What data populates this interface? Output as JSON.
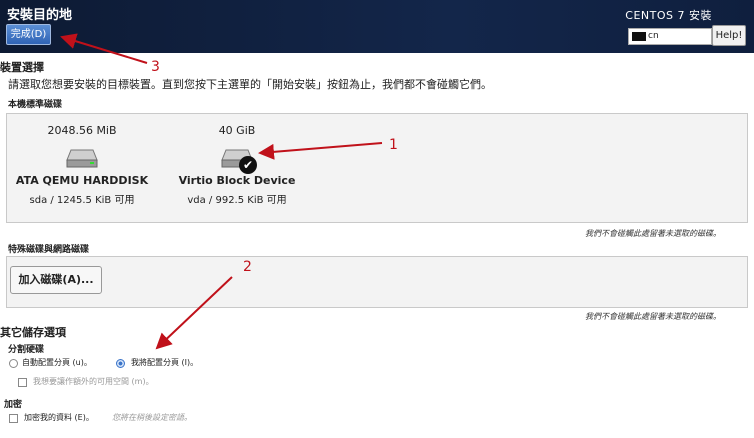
{
  "header": {
    "title": "安裝目的地",
    "done_label": "完成(D)",
    "product": "CENTOS 7 安裝",
    "keyboard": "cn",
    "help_label": "Help!"
  },
  "device_selection": {
    "heading": "裝置選擇",
    "description": "請選取您想要安裝的目標裝置。直到您按下主選單的「開始安裝」按鈕為止，我們都不會碰觸它們。",
    "local_disks_label": "本機標準磁碟",
    "disks": [
      {
        "size": "2048.56 MiB",
        "name": "ATA QEMU HARDDISK",
        "info": "sda  /  1245.5 KiB 可用",
        "selected": false
      },
      {
        "size": "40 GiB",
        "name": "Virtio Block Device",
        "info": "vda  /  992.5 KiB 可用",
        "selected": true
      }
    ],
    "note": "我們不會碰觸此處留著未選取的磁碟。"
  },
  "special_disks": {
    "label": "特殊磁碟與網路磁碟",
    "add_label": "加入磁碟(A)...",
    "note": "我們不會碰觸此處留著未選取的磁碟。"
  },
  "other_storage": {
    "heading": "其它儲存選項",
    "partitioning_label": "分割硬碟",
    "auto_label": "自動配置分頁 (u)。",
    "manual_label": "我將配置分頁 (I)。",
    "extra_space_label": "我想要讓作額外的可用空間 (m)。",
    "encryption_label": "加密",
    "encrypt_label": "加密我的資料 (E)。",
    "encrypt_hint": "您將在稍後設定密語。"
  },
  "annotations": {
    "marker1": "1",
    "marker2": "2",
    "marker3": "3",
    "color": "#c0111a"
  }
}
